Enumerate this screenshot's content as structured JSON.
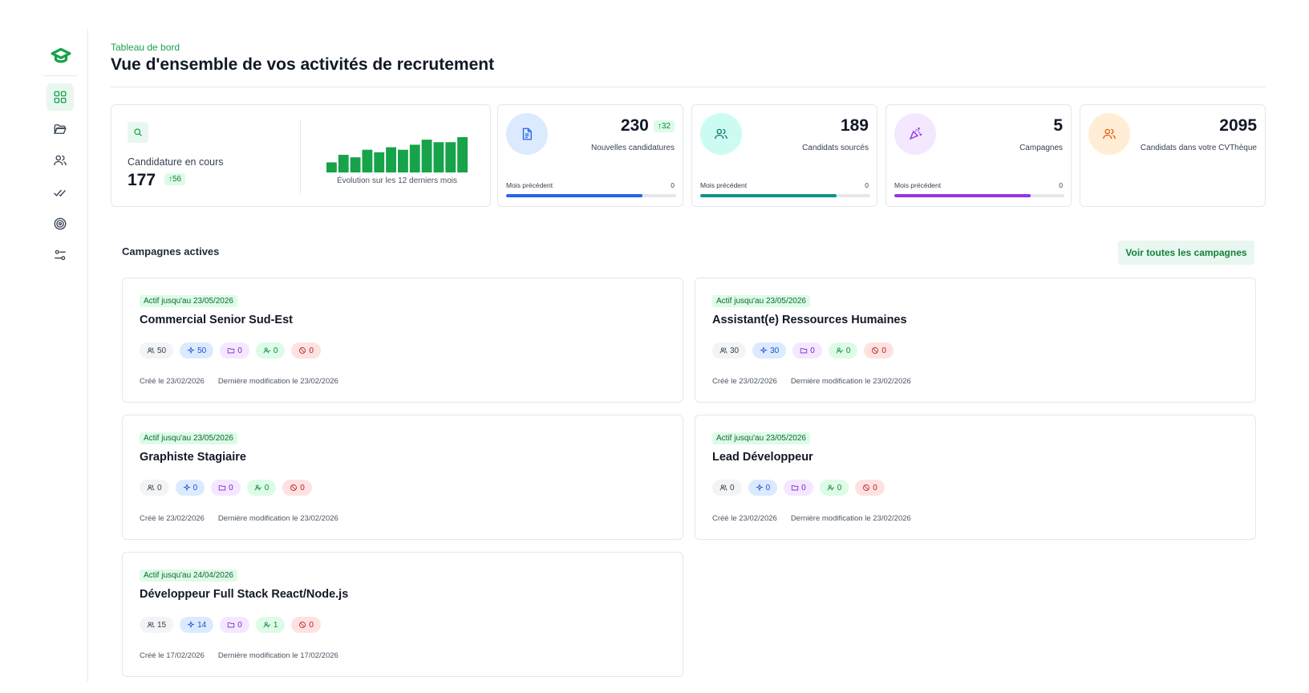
{
  "header": {
    "breadcrumb": "Tableau de bord",
    "title": "Vue d'ensemble de vos activités de recrutement"
  },
  "sidebar": {
    "items": [
      {
        "icon": "dashboard-icon",
        "active": true
      },
      {
        "icon": "folder-icon",
        "active": false
      },
      {
        "icon": "users-icon",
        "active": false
      },
      {
        "icon": "double-check-icon",
        "active": false
      },
      {
        "icon": "target-icon",
        "active": false
      },
      {
        "icon": "settings-sliders-icon",
        "active": false
      }
    ]
  },
  "overview": {
    "label": "Candidature en cours",
    "value": "177",
    "delta": "↑56",
    "chart_caption": "Évolution sur les 12 derniers mois",
    "chart_data": {
      "type": "bar",
      "values": [
        4,
        7,
        6,
        9,
        8,
        10,
        9,
        11,
        13,
        12,
        12,
        14
      ],
      "color": "#16a34a"
    }
  },
  "stats": [
    {
      "value": "230",
      "delta": "↑32",
      "label": "Nouvelles candidatures",
      "prev_label": "Mois précédent",
      "prev_value": "0",
      "progress": 0.8,
      "color": "#2563eb",
      "icon_bg": "#dbeafe",
      "icon_color": "#2563eb",
      "icon": "document-icon"
    },
    {
      "value": "189",
      "delta": "",
      "label": "Candidats sourcés",
      "prev_label": "Mois précédent",
      "prev_value": "0",
      "progress": 0.8,
      "color": "#0d9488",
      "icon_bg": "#ccfbf1",
      "icon_color": "#0f766e",
      "icon": "users-icon"
    },
    {
      "value": "5",
      "delta": "",
      "label": "Campagnes",
      "prev_label": "Mois précédent",
      "prev_value": "0",
      "progress": 0.8,
      "color": "#9333ea",
      "icon_bg": "#f3e8ff",
      "icon_color": "#9333ea",
      "icon": "party-icon"
    },
    {
      "value": "2095",
      "delta": "",
      "label": "Candidats dans votre CVThèque",
      "icon_bg": "#ffedd5",
      "icon_color": "#ea580c",
      "icon": "users-icon"
    }
  ],
  "campaigns_section": {
    "title": "Campagnes actives",
    "see_all": "Voir toutes les campagnes"
  },
  "campaigns": [
    {
      "tag": "Actif jusqu'au 23/05/2026",
      "title": "Commercial Senior Sud-Est",
      "candidates": "50",
      "sourced": "50",
      "folders": "0",
      "hired": "0",
      "rejected": "0",
      "created": "Créé le 23/02/2026",
      "modified": "Dernière modification le 23/02/2026"
    },
    {
      "tag": "Actif jusqu'au 23/05/2026",
      "title": "Assistant(e) Ressources Humaines",
      "candidates": "30",
      "sourced": "30",
      "folders": "0",
      "hired": "0",
      "rejected": "0",
      "created": "Créé le 23/02/2026",
      "modified": "Dernière modification le 23/02/2026"
    },
    {
      "tag": "Actif jusqu'au 23/05/2026",
      "title": "Graphiste Stagiaire",
      "candidates": "0",
      "sourced": "0",
      "folders": "0",
      "hired": "0",
      "rejected": "0",
      "created": "Créé le 23/02/2026",
      "modified": "Dernière modification le 23/02/2026"
    },
    {
      "tag": "Actif jusqu'au 23/05/2026",
      "title": "Lead Développeur",
      "candidates": "0",
      "sourced": "0",
      "folders": "0",
      "hired": "0",
      "rejected": "0",
      "created": "Créé le 23/02/2026",
      "modified": "Dernière modification le 23/02/2026"
    },
    {
      "tag": "Actif jusqu'au 24/04/2026",
      "title": "Développeur Full Stack React/Node.js",
      "candidates": "15",
      "sourced": "14",
      "folders": "0",
      "hired": "1",
      "rejected": "0",
      "created": "Créé le 17/02/2026",
      "modified": "Dernière modification le 17/02/2026"
    }
  ]
}
